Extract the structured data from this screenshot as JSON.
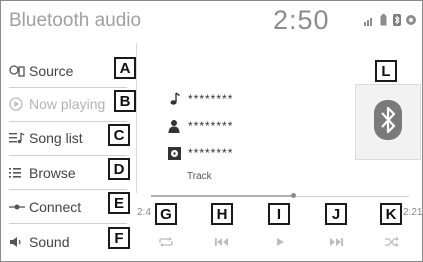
{
  "header": {
    "title": "Bluetooth audio",
    "clock": "2:50"
  },
  "status_icons": [
    "signal-icon",
    "battery-icon",
    "bluetooth-icon",
    "settings-icon"
  ],
  "menu": [
    {
      "label": "Source",
      "icon": "source-icon",
      "enabled": true
    },
    {
      "label": "Now playing",
      "icon": "now-playing-icon",
      "enabled": false
    },
    {
      "label": "Song list",
      "icon": "song-list-icon",
      "enabled": true
    },
    {
      "label": "Browse",
      "icon": "browse-icon",
      "enabled": true
    },
    {
      "label": "Connect",
      "icon": "connect-icon",
      "enabled": true
    },
    {
      "label": "Sound",
      "icon": "sound-icon",
      "enabled": true
    }
  ],
  "track_info": {
    "title": "********",
    "artist": "********",
    "album": "********",
    "label": "Track"
  },
  "playback": {
    "elapsed": "2:4",
    "total": "2:21",
    "progress": 0.55,
    "controls": [
      "repeat-icon",
      "previous-icon",
      "play-icon",
      "next-icon",
      "shuffle-icon"
    ]
  },
  "callouts": {
    "A": "A",
    "B": "B",
    "C": "C",
    "D": "D",
    "E": "E",
    "F": "F",
    "G": "G",
    "H": "H",
    "I": "I",
    "J": "J",
    "K": "K",
    "L": "L"
  },
  "colors": {
    "bluetooth_tile_bg": "#f2f2f2",
    "bluetooth_symbol": "#7a7a7a"
  }
}
